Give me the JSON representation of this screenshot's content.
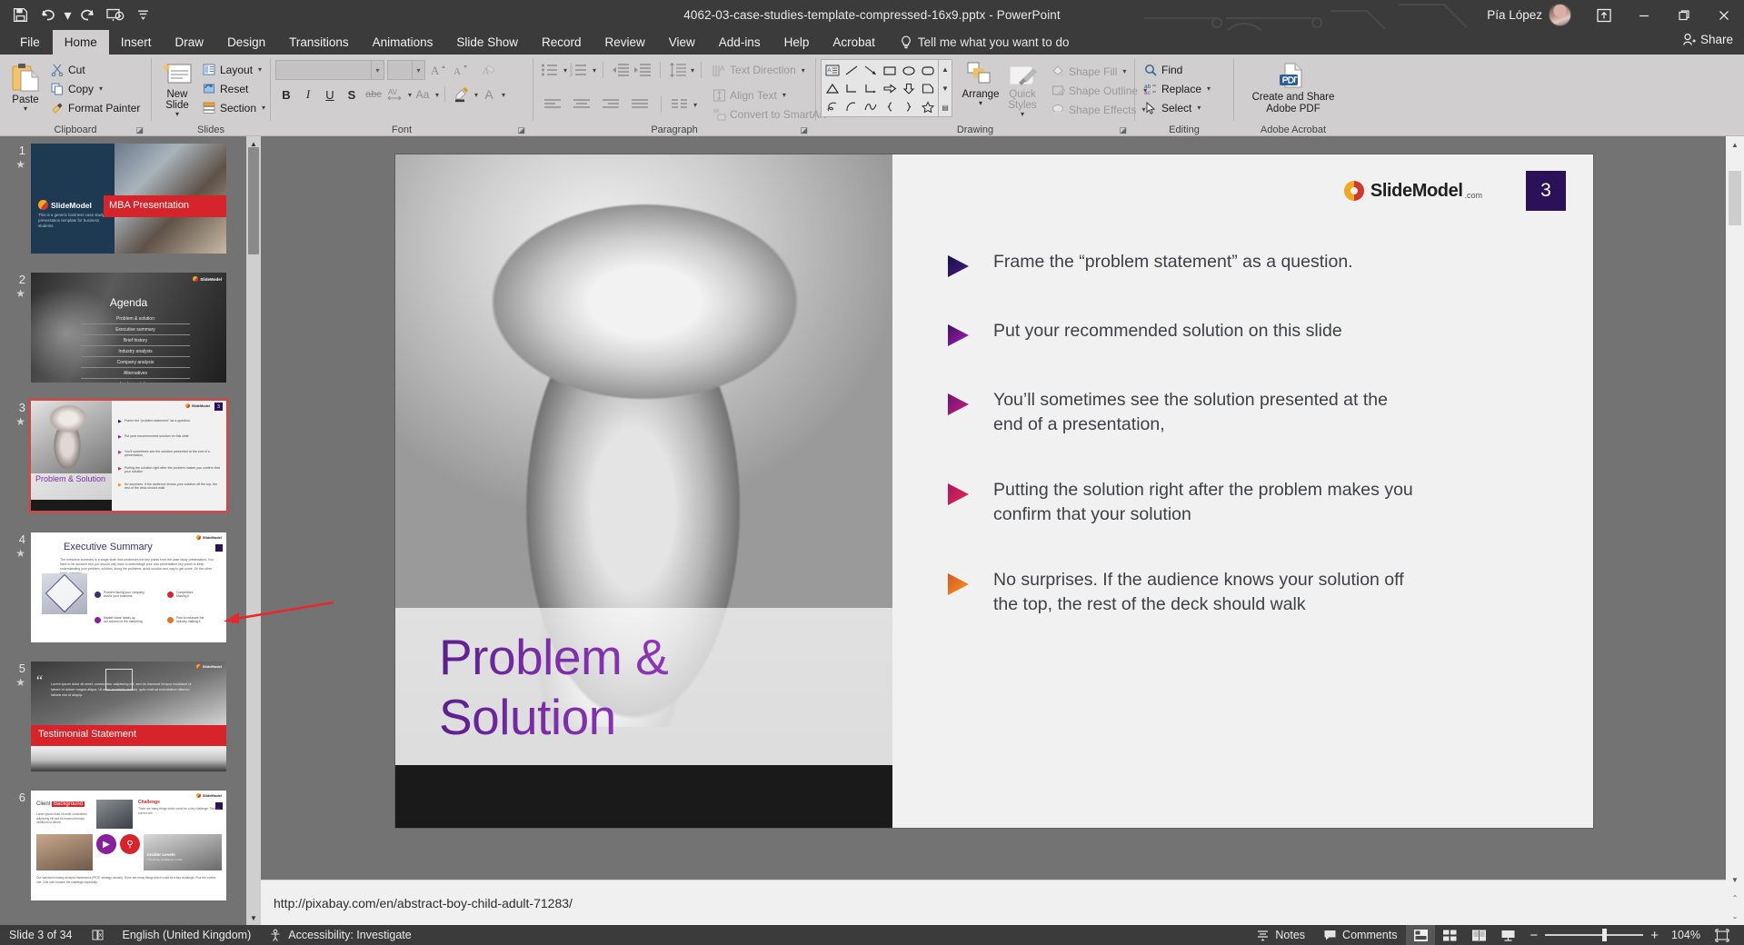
{
  "titlebar": {
    "document_title": "4062-03-case-studies-template-compressed-16x9.pptx  -  PowerPoint",
    "user_name": "Pía López",
    "qat": [
      {
        "name": "save",
        "label": "Save"
      },
      {
        "name": "undo",
        "label": "Undo"
      },
      {
        "name": "redo",
        "label": "Redo"
      },
      {
        "name": "start-from-beginning",
        "label": "Start From Beginning"
      },
      {
        "name": "customize-qat",
        "label": "Customize Quick Access Toolbar"
      }
    ],
    "window_controls": [
      {
        "name": "ribbon-display-options",
        "label": "Ribbon Display Options"
      },
      {
        "name": "minimize",
        "label": "Minimize"
      },
      {
        "name": "restore",
        "label": "Restore Down"
      },
      {
        "name": "close",
        "label": "Close"
      }
    ]
  },
  "tabs": [
    {
      "label": "File",
      "active": false
    },
    {
      "label": "Home",
      "active": true
    },
    {
      "label": "Insert",
      "active": false
    },
    {
      "label": "Draw",
      "active": false
    },
    {
      "label": "Design",
      "active": false
    },
    {
      "label": "Transitions",
      "active": false
    },
    {
      "label": "Animations",
      "active": false
    },
    {
      "label": "Slide Show",
      "active": false
    },
    {
      "label": "Record",
      "active": false
    },
    {
      "label": "Review",
      "active": false
    },
    {
      "label": "View",
      "active": false
    },
    {
      "label": "Add-ins",
      "active": false
    },
    {
      "label": "Help",
      "active": false
    },
    {
      "label": "Acrobat",
      "active": false
    }
  ],
  "tellme": "Tell me what you want to do",
  "share": "Share",
  "ribbon": {
    "groups": [
      {
        "label": "Clipboard",
        "has_launcher": true
      },
      {
        "label": "Slides",
        "has_launcher": false
      },
      {
        "label": "Font",
        "has_launcher": true
      },
      {
        "label": "Paragraph",
        "has_launcher": true
      },
      {
        "label": "Drawing",
        "has_launcher": true
      },
      {
        "label": "Editing",
        "has_launcher": false
      },
      {
        "label": "Adobe Acrobat",
        "has_launcher": false
      }
    ],
    "clipboard": {
      "paste": "Paste",
      "cut": "Cut",
      "copy": "Copy",
      "format_painter": "Format Painter"
    },
    "slides": {
      "new_slide": "New Slide",
      "layout": "Layout",
      "reset": "Reset",
      "section": "Section"
    },
    "font": {
      "font_name": "",
      "font_size": "",
      "font_name_placeholder": "",
      "buttons": [
        "B",
        "I",
        "U",
        "S",
        "abc",
        "AV",
        "Aa"
      ],
      "grow": "Increase Font Size",
      "shrink": "Decrease Font Size",
      "clear": "Clear All Formatting",
      "highlight": "Text Highlight Color",
      "fontcolor": "Font Color"
    },
    "paragraph": {
      "text_direction": "Text Direction",
      "align_text": "Align Text",
      "convert_smartart": "Convert to SmartArt"
    },
    "drawing": {
      "arrange": "Arrange",
      "quick_styles": "Quick Styles",
      "shape_fill": "Shape Fill",
      "shape_outline": "Shape Outline",
      "shape_effects": "Shape Effects"
    },
    "editing": {
      "find": "Find",
      "replace": "Replace",
      "select": "Select"
    },
    "acrobat": {
      "create_and_share": "Create and Share",
      "adobe_pdf": "Adobe PDF"
    }
  },
  "thumbnails": [
    {
      "number": "1",
      "title": "MBA Presentation",
      "type": "title-red",
      "selected": false
    },
    {
      "number": "2",
      "title": "Agenda",
      "type": "agenda",
      "selected": false
    },
    {
      "number": "3",
      "title": "Problem & Solution",
      "type": "problem",
      "selected": true
    },
    {
      "number": "4",
      "title": "Executive Summary",
      "type": "exec",
      "selected": false
    },
    {
      "number": "5",
      "title": "Testimonial Statement",
      "type": "testimonial",
      "selected": false
    },
    {
      "number": "6",
      "title": "Client Background",
      "type": "client",
      "selected": false
    }
  ],
  "slide": {
    "title_line1": "Problem &",
    "title_line2": "Solution",
    "page_number": "3",
    "logo_text": "SlideModel",
    "logo_suffix": ".com",
    "bullets": [
      {
        "text": "Frame the “problem statement” as a question.",
        "color_start": "#1b1464",
        "color_end": "#3b1d7a"
      },
      {
        "text": "Put your recommended solution on this slide",
        "color_start": "#4a1570",
        "color_end": "#a01fb0"
      },
      {
        "text": "You’ll sometimes see the solution presented at the end of a presentation,",
        "color_start": "#6d1470",
        "color_end": "#c51f8e"
      },
      {
        "text": "Putting the solution right after the problem makes you confirm that your solution",
        "color_start": "#a8156a",
        "color_end": "#e0285a"
      },
      {
        "text": "No surprises. If the audience knows your solution off the top, the rest of the deck should walk",
        "color_start": "#d4561f",
        "color_end": "#f58a1f"
      }
    ]
  },
  "notes_bar": {
    "text": "http://pixabay.com/en/abstract-boy-child-adult-71283/"
  },
  "statusbar": {
    "slide_counter": "Slide 3 of 34",
    "language": "English (United Kingdom)",
    "accessibility": "Accessibility: Investigate",
    "notes": "Notes",
    "comments": "Comments",
    "zoom_level": "104%",
    "views": [
      {
        "name": "normal-view",
        "active": true
      },
      {
        "name": "slide-sorter-view",
        "active": false
      },
      {
        "name": "reading-view",
        "active": false
      },
      {
        "name": "slide-show-view",
        "active": false
      }
    ]
  },
  "colors": {
    "chrome_dark": "#3b3b3b",
    "ribbon_bg": "#d0cece",
    "workspace_gray": "#737373",
    "accent_purple": "#7b2da8",
    "slide_number_bg": "#2b1158",
    "annotation_red": "#e8272c"
  }
}
